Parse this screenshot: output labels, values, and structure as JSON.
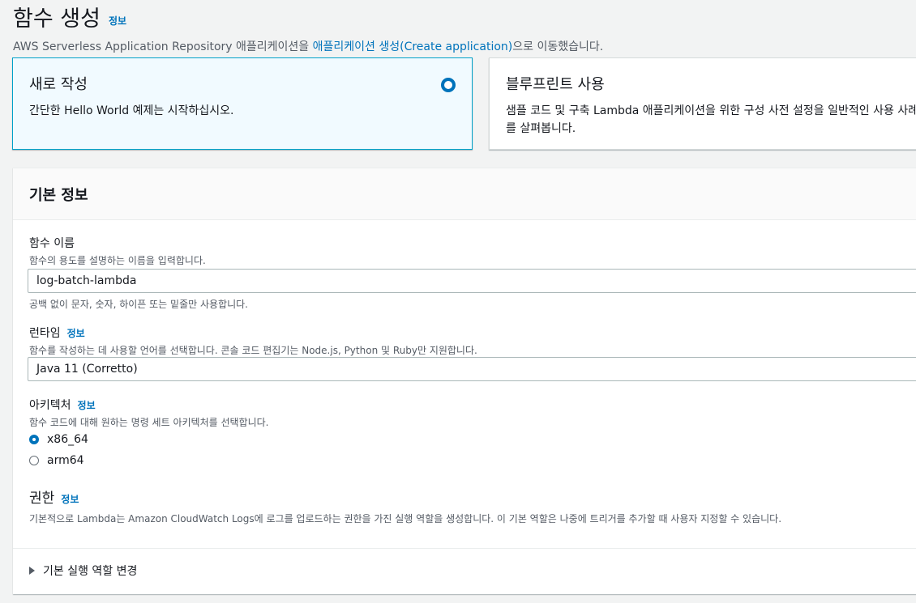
{
  "header": {
    "title": "함수 생성",
    "info_link": "정보",
    "subtitle_before": "AWS Serverless Application Repository 애플리케이션을 ",
    "subtitle_link": "애플리케이션 생성(Create application)",
    "subtitle_after": "으로 이동했습니다."
  },
  "options": [
    {
      "title": "새로 작성",
      "desc": "간단한 Hello World 예제는 시작하십시오.",
      "selected": true
    },
    {
      "title": "블루프린트 사용",
      "desc": "샘플 코드 및 구축 Lambda 애플리케이션을 위한 구성 사전 설정을 일반적인 사용 사례를 살펴봅니다.",
      "selected": false
    }
  ],
  "basic_info": {
    "title": "기본 정보",
    "function_name": {
      "label": "함수 이름",
      "desc": "함수의 용도를 설명하는 이름을 입력합니다.",
      "value": "log-batch-lambda",
      "constraint": "공백 없이 문자, 숫자, 하이픈 또는 밑줄만 사용합니다."
    },
    "runtime": {
      "label": "런타임",
      "info": "정보",
      "desc": "함수를 작성하는 데 사용할 언어를 선택합니다. 콘솔 코드 편집기는 Node.js, Python 및 Ruby만 지원합니다.",
      "value": "Java 11 (Corretto)"
    },
    "architecture": {
      "label": "아키텍처",
      "info": "정보",
      "desc": "함수 코드에 대해 원하는 명령 세트 아키텍처를 선택합니다.",
      "options": [
        "x86_64",
        "arm64"
      ],
      "selected": "x86_64"
    },
    "permissions": {
      "label": "권한",
      "info": "정보",
      "desc": "기본적으로 Lambda는 Amazon CloudWatch Logs에 로그를 업로드하는 권한을 가진 실행 역할을 생성합니다. 이 기본 역할은 나중에 트리거를 추가할 때 사용자 지정할 수 있습니다."
    },
    "expand_label": "기본 실행 역할 변경"
  }
}
